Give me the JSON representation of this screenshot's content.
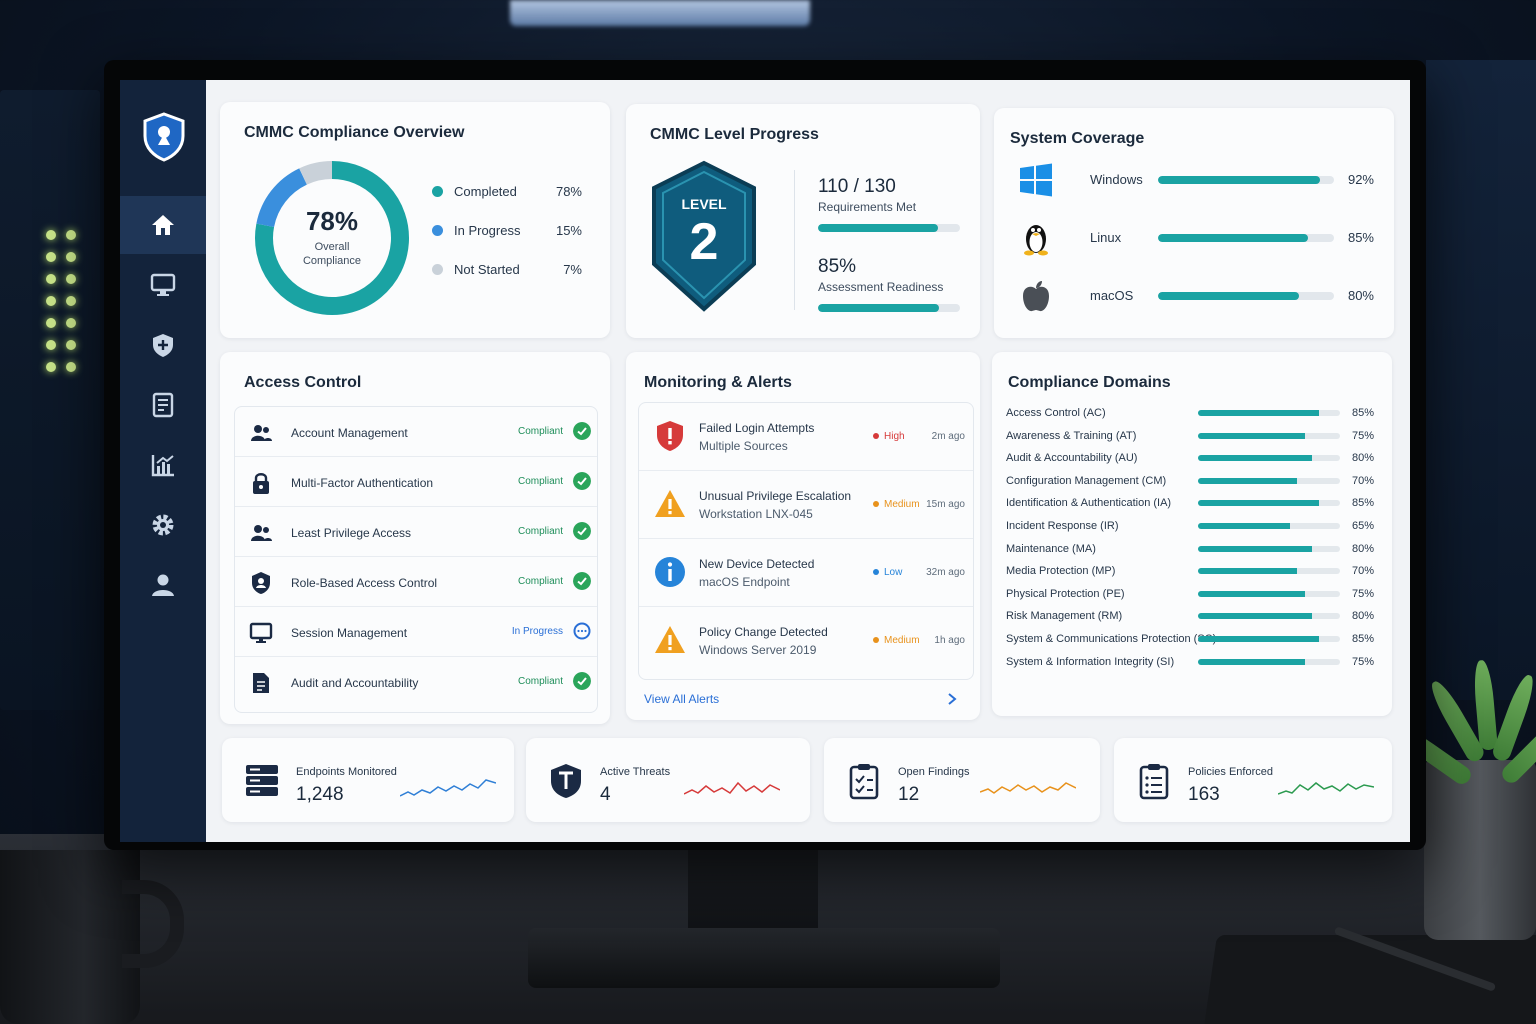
{
  "overview": {
    "title": "CMMC Compliance Overview",
    "donut_value": "78%",
    "donut_line1": "Overall",
    "donut_line2": "Compliance",
    "segments": [
      {
        "label": "Completed",
        "pct": "78%",
        "value": 78,
        "color": "#1aa3a3"
      },
      {
        "label": "In Progress",
        "pct": "15%",
        "value": 15,
        "color": "#3a8fdd"
      },
      {
        "label": "Not Started",
        "pct": "7%",
        "value": 7,
        "color": "#c9d1d9"
      }
    ]
  },
  "level": {
    "title": "CMMC Level Progress",
    "badge_word": "LEVEL",
    "badge_number": "2",
    "req_value": "110 / 130",
    "req_label": "Requirements Met",
    "req_fraction": 0.846,
    "readiness_value": "85%",
    "readiness_label": "Assessment Readiness",
    "readiness_fraction": 0.85
  },
  "coverage": {
    "title": "System Coverage",
    "items": [
      {
        "icon": "windows-icon",
        "name": "Windows",
        "pct": "92%",
        "value": 0.92
      },
      {
        "icon": "linux-icon",
        "name": "Linux",
        "pct": "85%",
        "value": 0.85
      },
      {
        "icon": "apple-icon",
        "name": "macOS",
        "pct": "80%",
        "value": 0.8
      }
    ]
  },
  "access": {
    "title": "Access Control",
    "items": [
      {
        "icon": "users-icon",
        "name": "Account Management",
        "status": "Compliant"
      },
      {
        "icon": "lock-icon",
        "name": "Multi-Factor Authentication",
        "status": "Compliant"
      },
      {
        "icon": "users-icon",
        "name": "Least Privilege Access",
        "status": "Compliant"
      },
      {
        "icon": "shield-user-icon",
        "name": "Role-Based Access Control",
        "status": "Compliant"
      },
      {
        "icon": "monitor-icon",
        "name": "Session Management",
        "status": "In Progress"
      },
      {
        "icon": "document-icon",
        "name": "Audit and Accountability",
        "status": "Compliant"
      }
    ]
  },
  "alerts": {
    "title": "Monitoring & Alerts",
    "items": [
      {
        "icon": "shield-alert-icon",
        "title": "Failed Login Attempts",
        "subtitle": "Multiple Sources",
        "severity": "High",
        "sev_color": "#d63a3a",
        "time": "2m ago"
      },
      {
        "icon": "warning-icon",
        "title": "Unusual Privilege Escalation",
        "subtitle": "Workstation LNX-045",
        "severity": "Medium",
        "sev_color": "#e8921c",
        "time": "15m ago"
      },
      {
        "icon": "info-icon",
        "title": "New Device Detected",
        "subtitle": "macOS Endpoint",
        "severity": "Low",
        "sev_color": "#2684d9",
        "time": "32m ago"
      },
      {
        "icon": "warning-icon",
        "title": "Policy Change Detected",
        "subtitle": "Windows Server 2019",
        "severity": "Medium",
        "sev_color": "#e8921c",
        "time": "1h ago"
      }
    ],
    "view_all": "View All Alerts"
  },
  "domains": {
    "title": "Compliance Domains",
    "items": [
      {
        "name": "Access Control (AC)",
        "pct": "85%",
        "value": 0.85
      },
      {
        "name": "Awareness & Training (AT)",
        "pct": "75%",
        "value": 0.75
      },
      {
        "name": "Audit & Accountability (AU)",
        "pct": "80%",
        "value": 0.8
      },
      {
        "name": "Configuration Management (CM)",
        "pct": "70%",
        "value": 0.7
      },
      {
        "name": "Identification & Authentication (IA)",
        "pct": "85%",
        "value": 0.85
      },
      {
        "name": "Incident Response (IR)",
        "pct": "65%",
        "value": 0.65
      },
      {
        "name": "Maintenance (MA)",
        "pct": "80%",
        "value": 0.8
      },
      {
        "name": "Media Protection (MP)",
        "pct": "70%",
        "value": 0.7
      },
      {
        "name": "Physical Protection (PE)",
        "pct": "75%",
        "value": 0.75
      },
      {
        "name": "Risk Management (RM)",
        "pct": "80%",
        "value": 0.8
      },
      {
        "name": "System & Communications Protection (SC)",
        "pct": "85%",
        "value": 0.85
      },
      {
        "name": "System & Information Integrity (SI)",
        "pct": "75%",
        "value": 0.75
      }
    ]
  },
  "kpis": [
    {
      "icon": "server-icon",
      "label": "Endpoints Monitored",
      "value": "1,248",
      "color": "#2f7fd6"
    },
    {
      "icon": "threat-shield-icon",
      "label": "Active Threats",
      "value": "4",
      "color": "#d63a3a"
    },
    {
      "icon": "clipboard-check-icon",
      "label": "Open Findings",
      "value": "12",
      "color": "#e8921c"
    },
    {
      "icon": "clipboard-list-icon",
      "label": "Policies Enforced",
      "value": "163",
      "color": "#2b9a4f"
    }
  ],
  "sidebar": {
    "items": [
      "home-icon",
      "monitor-icon",
      "shield-icon",
      "report-icon",
      "analytics-icon",
      "settings-icon",
      "user-icon"
    ]
  }
}
